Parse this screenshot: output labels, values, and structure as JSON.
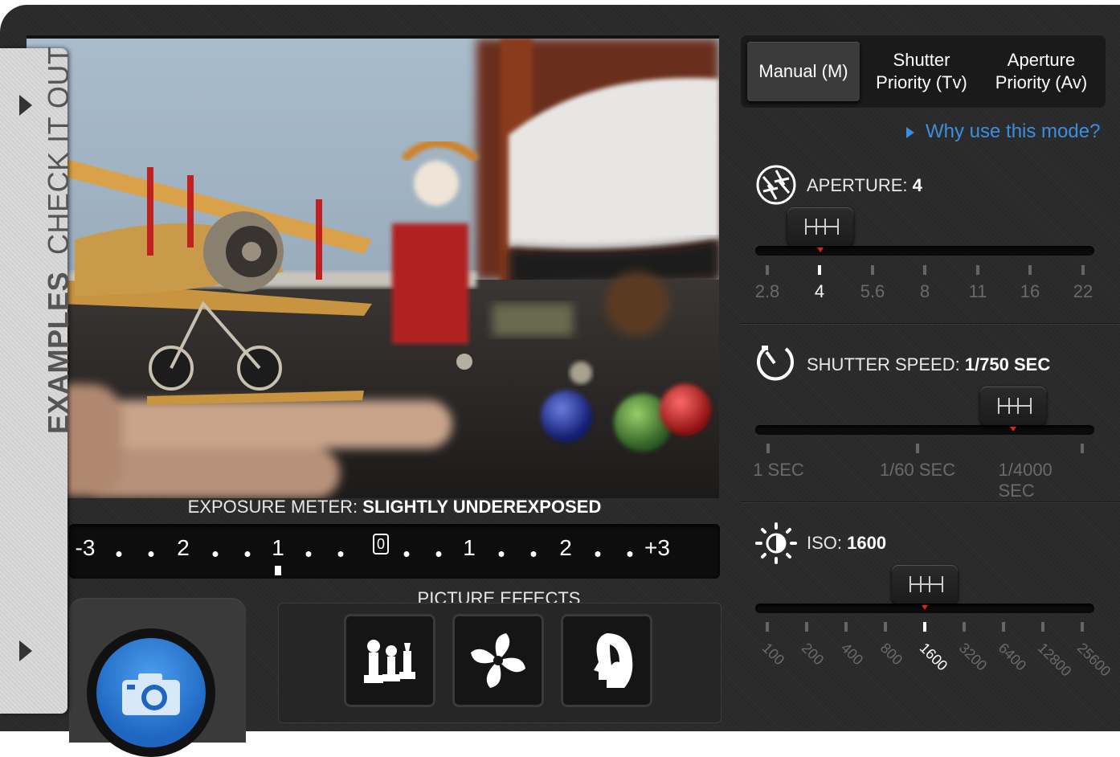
{
  "sidebar": {
    "label_bold": "EXAMPLES",
    "label_light": "CHECK IT OUT"
  },
  "exposure_meter": {
    "label": "EXPOSURE METER:",
    "value": "SLIGHTLY UNDEREXPOSED",
    "scale": [
      "-3",
      "2",
      "1",
      "0",
      "1",
      "2",
      "+3"
    ],
    "indicator_stops": -1
  },
  "picture_effects": {
    "title": "PICTURE EFFECTS",
    "buttons": [
      {
        "icon": "chess-pieces-icon"
      },
      {
        "icon": "pinwheel-icon"
      },
      {
        "icon": "portrait-profile-icon"
      }
    ]
  },
  "shutter_button": {
    "icon": "camera-icon"
  },
  "modes": {
    "manual": "Manual (M)",
    "shutter_priority_line1": "Shutter",
    "shutter_priority_line2": "Priority (Tv)",
    "aperture_priority_line1": "Aperture",
    "aperture_priority_line2": "Priority (Av)",
    "active": "manual"
  },
  "why_link": "Why use this mode?",
  "aperture": {
    "label": "APERTURE:",
    "value": "4",
    "ticks": [
      "2.8",
      "4",
      "5.6",
      "8",
      "11",
      "16",
      "22"
    ],
    "selected": "4"
  },
  "shutter_speed": {
    "label": "SHUTTER SPEED:",
    "value": "1/750 SEC",
    "ticks": [
      "1 SEC",
      "1/60 SEC",
      "1/4000 SEC"
    ],
    "position_fraction": 0.76
  },
  "iso": {
    "label": "ISO:",
    "value": "1600",
    "ticks": [
      "100",
      "200",
      "400",
      "800",
      "1600",
      "3200",
      "6400",
      "12800",
      "25600"
    ],
    "selected": "1600"
  },
  "colors": {
    "accent_link": "#3b8fe0",
    "shutter_button": "#2a7fd8",
    "indicator_red": "#e02020"
  }
}
